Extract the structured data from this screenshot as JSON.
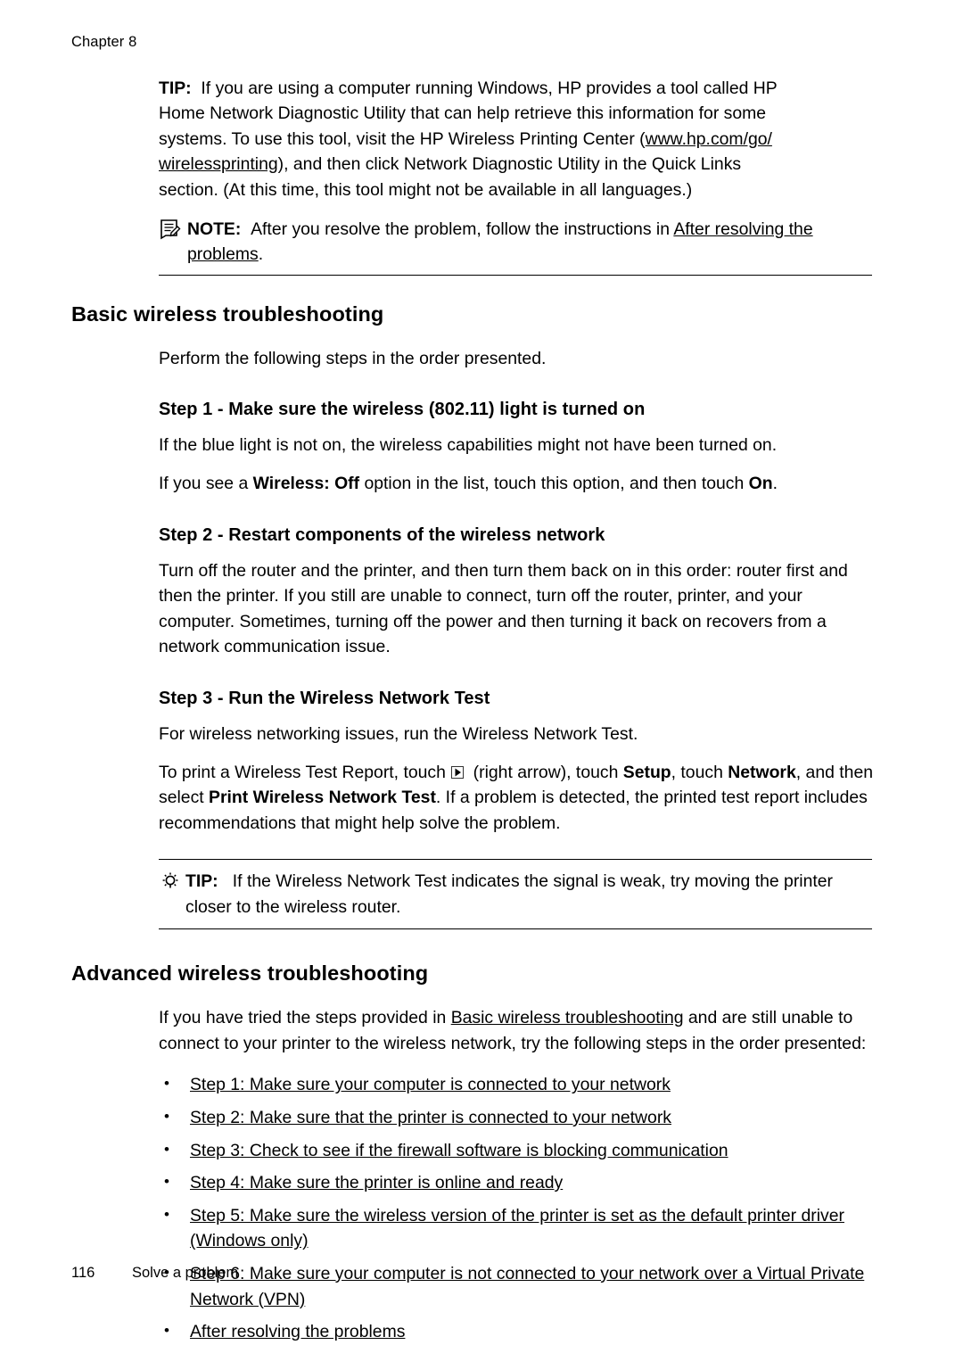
{
  "chapter": "Chapter 8",
  "tip1": {
    "label": "TIP:",
    "line1": "If you are using a computer running Windows, HP provides a tool called HP",
    "line2": "Home Network Diagnostic Utility that can help retrieve this information for some",
    "line3_a": "systems. To use this tool, visit the HP Wireless Printing Center (",
    "link": "www.hp.com/go/",
    "link2": "wirelessprinting",
    "line4_b": "), and then click Network Diagnostic Utility in the Quick Links",
    "line5": "section. (At this time, this tool might not be available in all languages.)"
  },
  "note": {
    "icon": "note-icon",
    "label": "NOTE:",
    "text_a": "After you resolve the problem, follow the instructions in ",
    "link": "After resolving the",
    "link_cont": "problems",
    "text_b": "."
  },
  "section1": {
    "heading": "Basic wireless troubleshooting",
    "intro": "Perform the following steps in the order presented.",
    "step1": {
      "heading": "Step 1 - Make sure the wireless (802.11) light is turned on",
      "p1": "If the blue light is not on, the wireless capabilities might not have been turned on.",
      "p2_a": "If you see a ",
      "p2_b": "Wireless: Off",
      "p2_c": " option in the list, touch this option, and then touch ",
      "p2_d": "On",
      "p2_e": "."
    },
    "step2": {
      "heading": "Step 2 - Restart components of the wireless network",
      "p1": "Turn off the router and the printer, and then turn them back on in this order: router first and then the printer. If you still are unable to connect, turn off the router, printer, and your computer. Sometimes, turning off the power and then turning it back on recovers from a network communication issue."
    },
    "step3": {
      "heading": "Step 3 - Run the Wireless Network Test",
      "p1": "For wireless networking issues, run the Wireless Network Test.",
      "p2_a": "To print a Wireless Test Report, touch ",
      "p2_icon": "right-arrow-icon",
      "p2_b": " (right arrow), touch ",
      "p2_setup": "Setup",
      "p2_c": ", touch ",
      "p2_network": "Network",
      "p2_d": ", and then select ",
      "p2_print": "Print Wireless Network Test",
      "p2_e": ". If a problem is detected, the printed test report includes recommendations that might help solve the problem."
    }
  },
  "tip2": {
    "icon": "lightbulb-icon",
    "label": "TIP:",
    "text": "If the Wireless Network Test indicates the signal is weak, try moving the printer closer to the wireless router."
  },
  "section2": {
    "heading": "Advanced wireless troubleshooting",
    "intro_a": "If you have tried the steps provided in ",
    "intro_link": "Basic wireless troubleshooting",
    "intro_b": " and are still unable to connect to your printer to the wireless network, try the following steps in the order presented:",
    "bullets": [
      "Step 1: Make sure your computer is connected to your network",
      "Step 2: Make sure that the printer is connected to your network",
      "Step 3: Check to see if the firewall software is blocking communication",
      "Step 4: Make sure the printer is online and ready",
      "Step 5: Make sure the wireless version of the printer is set as the default printer driver (Windows only)",
      "Step 6: Make sure your computer is not connected to your network over a Virtual Private Network (VPN)",
      "After resolving the problems"
    ]
  },
  "footer": {
    "page_number": "116",
    "section_name": "Solve a problem"
  }
}
